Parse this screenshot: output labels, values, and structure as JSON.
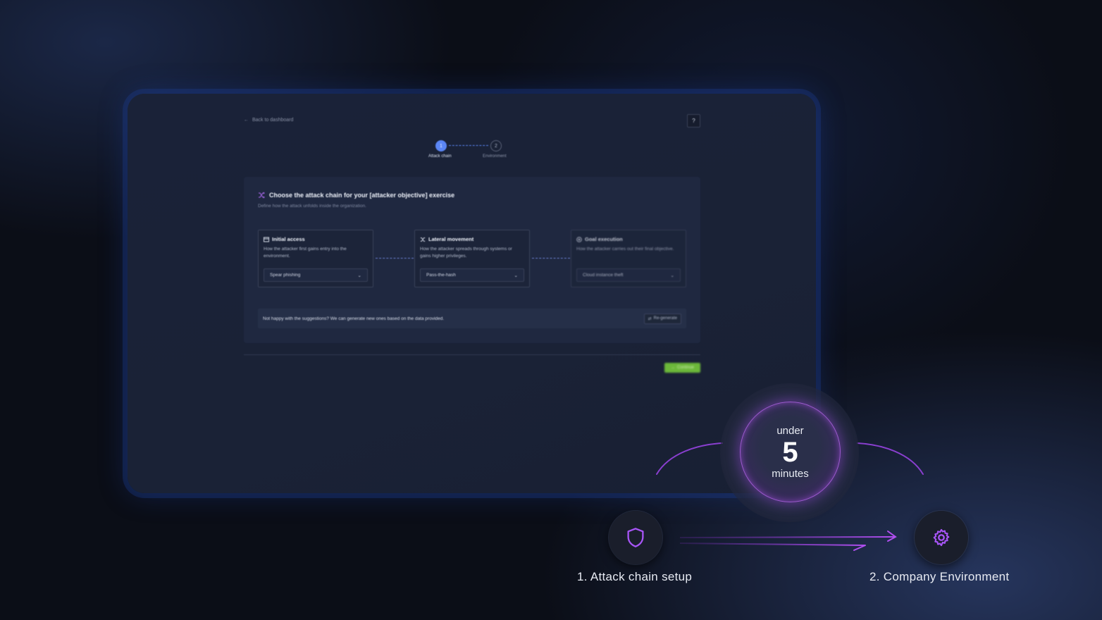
{
  "app": {
    "back_link": "Back to dashboard",
    "help_label": "?",
    "stepper": {
      "steps": [
        {
          "number": "1",
          "label": "Attack chain"
        },
        {
          "number": "2",
          "label": "Environment"
        }
      ]
    },
    "card": {
      "title": "Choose the attack chain for your [attacker objective] exercise",
      "subtitle": "Define how the attack unfolds inside the organization.",
      "stages": [
        {
          "title": "Initial access",
          "description": "How the attacker first gains entry into the environment.",
          "selected": "Spear phishing",
          "icon": "door-icon"
        },
        {
          "title": "Lateral movement",
          "description": "How the attacker spreads through systems or gains higher privileges.",
          "selected": "Pass-the-hash",
          "icon": "shuffle-icon"
        },
        {
          "title": "Goal execution",
          "description": "How the attacker carries out their final objective.",
          "selected": "Cloud instance theft",
          "icon": "target-icon"
        }
      ],
      "regen_message": "Not happy with the suggestions? We can generate new ones based on the data provided.",
      "regen_button": "Re-generate"
    },
    "continue_button": "Continue"
  },
  "timer": {
    "top": "under",
    "value": "5",
    "bottom": "minutes"
  },
  "steps": [
    {
      "label": "1. Attack chain setup",
      "icon": "shield-icon"
    },
    {
      "label": "2. Company Environment",
      "icon": "gear-icon"
    }
  ],
  "colors": {
    "accent_purple": "#a855f7",
    "accent_blue": "#5b86f5",
    "continue_green": "#6cb83a"
  }
}
